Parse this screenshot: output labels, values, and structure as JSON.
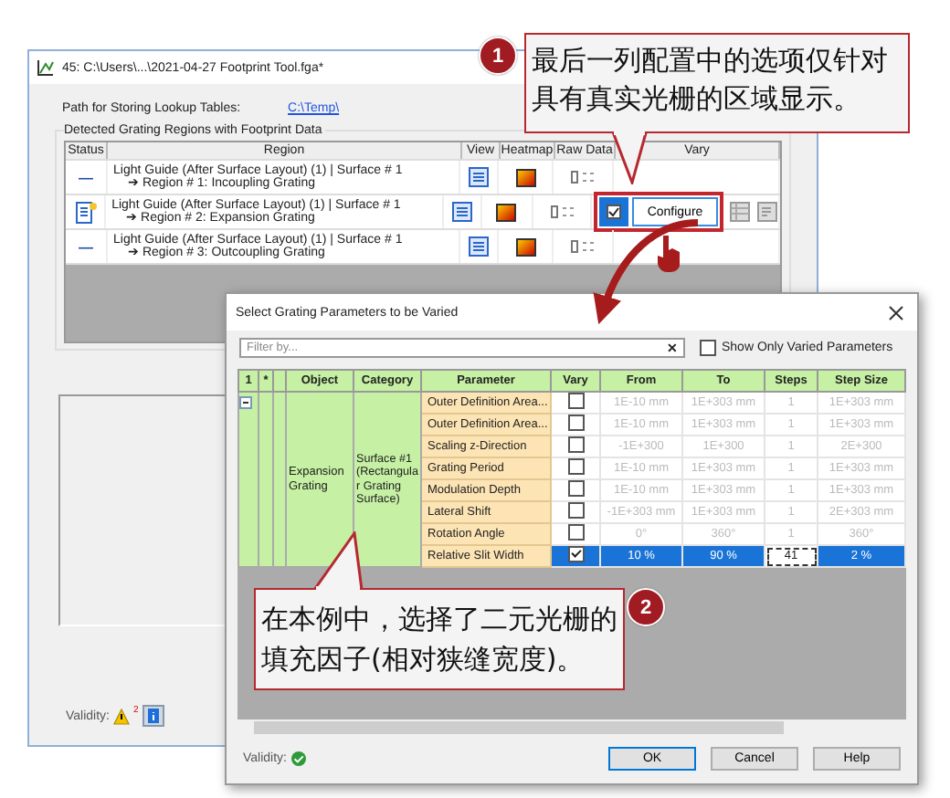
{
  "main_window": {
    "title": "45: C:\\Users\\...\\2021-04-27 Footprint Tool.fga*",
    "path_label": "Path for Storing Lookup Tables:",
    "path_link": "C:\\Temp\\",
    "group_title": "Detected Grating Regions with Footprint Data",
    "table": {
      "columns": [
        "Status",
        "Region",
        "View",
        "Heatmap",
        "Raw Data",
        "Vary"
      ],
      "rows": [
        {
          "kind": "inactive",
          "status": "—",
          "region": "Light Guide (After Surface Layout) (1) | Surface # 1",
          "subregion": "➔ Region # 1: Incoupling Grating"
        },
        {
          "kind": "active",
          "region": "Light Guide (After Surface Layout) (1) | Surface # 1",
          "subregion": "➔ Region # 2: Expansion Grating",
          "vary_checked": true,
          "vary_button": "Configure"
        },
        {
          "kind": "inactive",
          "status": "—",
          "region": "Light Guide (After Surface Layout) (1) | Surface # 1",
          "subregion": "➔ Region # 3: Outcoupling Grating"
        }
      ]
    },
    "validity_label": "Validity:",
    "warning_count": "2"
  },
  "dialog": {
    "title": "Select Grating Parameters to be Varied",
    "filter_placeholder": "Filter by...",
    "clear": "✕",
    "show_only_varied": {
      "label": "Show Only Varied Parameters",
      "checked": false
    },
    "columns": [
      "1",
      "*",
      "",
      "Object",
      "Category",
      "Parameter",
      "Vary",
      "From",
      "To",
      "Steps",
      "Step Size"
    ],
    "object": "Expansion Grating",
    "category": "Surface #1 (Rectangular Grating Surface)",
    "rows": [
      {
        "parameter": "Outer Definition Area...",
        "vary": false,
        "from": "1E-10 mm",
        "to": "1E+303 mm",
        "steps": "1",
        "step_size": "1E+303 mm",
        "selected": false
      },
      {
        "parameter": "Outer Definition Area...",
        "vary": false,
        "from": "1E-10 mm",
        "to": "1E+303 mm",
        "steps": "1",
        "step_size": "1E+303 mm",
        "selected": false
      },
      {
        "parameter": "Scaling z-Direction",
        "vary": false,
        "from": "-1E+300",
        "to": "1E+300",
        "steps": "1",
        "step_size": "2E+300",
        "selected": false
      },
      {
        "parameter": "Grating Period",
        "vary": false,
        "from": "1E-10 mm",
        "to": "1E+303 mm",
        "steps": "1",
        "step_size": "1E+303 mm",
        "selected": false
      },
      {
        "parameter": "Modulation Depth",
        "vary": false,
        "from": "1E-10 mm",
        "to": "1E+303 mm",
        "steps": "1",
        "step_size": "1E+303 mm",
        "selected": false
      },
      {
        "parameter": "Lateral Shift",
        "vary": false,
        "from": "-1E+303 mm",
        "to": "1E+303 mm",
        "steps": "1",
        "step_size": "2E+303 mm",
        "selected": false
      },
      {
        "parameter": "Rotation Angle",
        "vary": false,
        "from": "0°",
        "to": "360°",
        "steps": "1",
        "step_size": "360°",
        "selected": false
      },
      {
        "parameter": "Relative Slit Width",
        "vary": true,
        "from": "10 %",
        "to": "90 %",
        "steps": "41",
        "step_size": "2 %",
        "selected": true
      }
    ],
    "validity_label": "Validity:",
    "buttons": [
      "OK",
      "Cancel",
      "Help"
    ]
  },
  "callouts": [
    {
      "number": "1",
      "text": "最后一列配置中的选项仅针对具有真实光栅的区域显示。"
    },
    {
      "number": "2",
      "text": "在本例中，选择了二元光栅的填充因子(相对狭缝宽度)。"
    }
  ]
}
